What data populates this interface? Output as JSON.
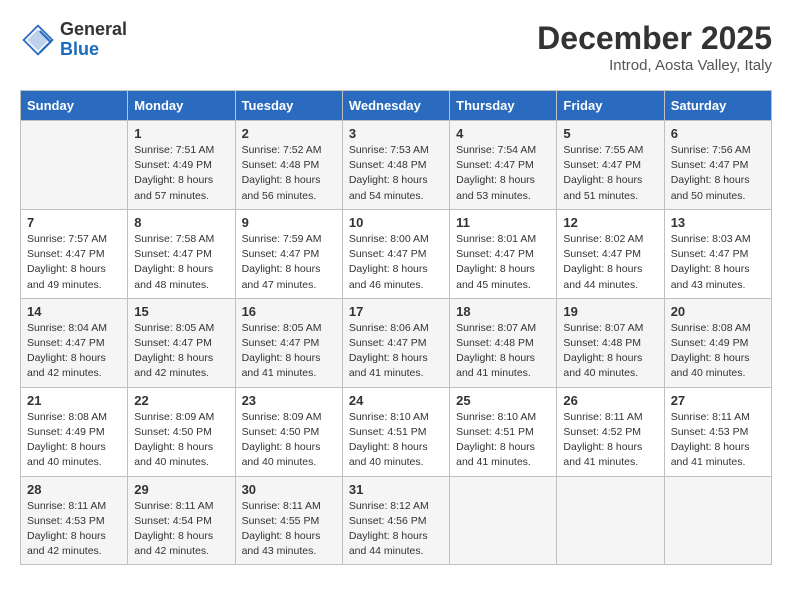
{
  "header": {
    "logo_general": "General",
    "logo_blue": "Blue",
    "month_year": "December 2025",
    "location": "Introd, Aosta Valley, Italy"
  },
  "days_of_week": [
    "Sunday",
    "Monday",
    "Tuesday",
    "Wednesday",
    "Thursday",
    "Friday",
    "Saturday"
  ],
  "weeks": [
    [
      {
        "day": "",
        "content": ""
      },
      {
        "day": "1",
        "content": "Sunrise: 7:51 AM\nSunset: 4:49 PM\nDaylight: 8 hours\nand 57 minutes."
      },
      {
        "day": "2",
        "content": "Sunrise: 7:52 AM\nSunset: 4:48 PM\nDaylight: 8 hours\nand 56 minutes."
      },
      {
        "day": "3",
        "content": "Sunrise: 7:53 AM\nSunset: 4:48 PM\nDaylight: 8 hours\nand 54 minutes."
      },
      {
        "day": "4",
        "content": "Sunrise: 7:54 AM\nSunset: 4:47 PM\nDaylight: 8 hours\nand 53 minutes."
      },
      {
        "day": "5",
        "content": "Sunrise: 7:55 AM\nSunset: 4:47 PM\nDaylight: 8 hours\nand 51 minutes."
      },
      {
        "day": "6",
        "content": "Sunrise: 7:56 AM\nSunset: 4:47 PM\nDaylight: 8 hours\nand 50 minutes."
      }
    ],
    [
      {
        "day": "7",
        "content": "Sunrise: 7:57 AM\nSunset: 4:47 PM\nDaylight: 8 hours\nand 49 minutes."
      },
      {
        "day": "8",
        "content": "Sunrise: 7:58 AM\nSunset: 4:47 PM\nDaylight: 8 hours\nand 48 minutes."
      },
      {
        "day": "9",
        "content": "Sunrise: 7:59 AM\nSunset: 4:47 PM\nDaylight: 8 hours\nand 47 minutes."
      },
      {
        "day": "10",
        "content": "Sunrise: 8:00 AM\nSunset: 4:47 PM\nDaylight: 8 hours\nand 46 minutes."
      },
      {
        "day": "11",
        "content": "Sunrise: 8:01 AM\nSunset: 4:47 PM\nDaylight: 8 hours\nand 45 minutes."
      },
      {
        "day": "12",
        "content": "Sunrise: 8:02 AM\nSunset: 4:47 PM\nDaylight: 8 hours\nand 44 minutes."
      },
      {
        "day": "13",
        "content": "Sunrise: 8:03 AM\nSunset: 4:47 PM\nDaylight: 8 hours\nand 43 minutes."
      }
    ],
    [
      {
        "day": "14",
        "content": "Sunrise: 8:04 AM\nSunset: 4:47 PM\nDaylight: 8 hours\nand 42 minutes."
      },
      {
        "day": "15",
        "content": "Sunrise: 8:05 AM\nSunset: 4:47 PM\nDaylight: 8 hours\nand 42 minutes."
      },
      {
        "day": "16",
        "content": "Sunrise: 8:05 AM\nSunset: 4:47 PM\nDaylight: 8 hours\nand 41 minutes."
      },
      {
        "day": "17",
        "content": "Sunrise: 8:06 AM\nSunset: 4:47 PM\nDaylight: 8 hours\nand 41 minutes."
      },
      {
        "day": "18",
        "content": "Sunrise: 8:07 AM\nSunset: 4:48 PM\nDaylight: 8 hours\nand 41 minutes."
      },
      {
        "day": "19",
        "content": "Sunrise: 8:07 AM\nSunset: 4:48 PM\nDaylight: 8 hours\nand 40 minutes."
      },
      {
        "day": "20",
        "content": "Sunrise: 8:08 AM\nSunset: 4:49 PM\nDaylight: 8 hours\nand 40 minutes."
      }
    ],
    [
      {
        "day": "21",
        "content": "Sunrise: 8:08 AM\nSunset: 4:49 PM\nDaylight: 8 hours\nand 40 minutes."
      },
      {
        "day": "22",
        "content": "Sunrise: 8:09 AM\nSunset: 4:50 PM\nDaylight: 8 hours\nand 40 minutes."
      },
      {
        "day": "23",
        "content": "Sunrise: 8:09 AM\nSunset: 4:50 PM\nDaylight: 8 hours\nand 40 minutes."
      },
      {
        "day": "24",
        "content": "Sunrise: 8:10 AM\nSunset: 4:51 PM\nDaylight: 8 hours\nand 40 minutes."
      },
      {
        "day": "25",
        "content": "Sunrise: 8:10 AM\nSunset: 4:51 PM\nDaylight: 8 hours\nand 41 minutes."
      },
      {
        "day": "26",
        "content": "Sunrise: 8:11 AM\nSunset: 4:52 PM\nDaylight: 8 hours\nand 41 minutes."
      },
      {
        "day": "27",
        "content": "Sunrise: 8:11 AM\nSunset: 4:53 PM\nDaylight: 8 hours\nand 41 minutes."
      }
    ],
    [
      {
        "day": "28",
        "content": "Sunrise: 8:11 AM\nSunset: 4:53 PM\nDaylight: 8 hours\nand 42 minutes."
      },
      {
        "day": "29",
        "content": "Sunrise: 8:11 AM\nSunset: 4:54 PM\nDaylight: 8 hours\nand 42 minutes."
      },
      {
        "day": "30",
        "content": "Sunrise: 8:11 AM\nSunset: 4:55 PM\nDaylight: 8 hours\nand 43 minutes."
      },
      {
        "day": "31",
        "content": "Sunrise: 8:12 AM\nSunset: 4:56 PM\nDaylight: 8 hours\nand 44 minutes."
      },
      {
        "day": "",
        "content": ""
      },
      {
        "day": "",
        "content": ""
      },
      {
        "day": "",
        "content": ""
      }
    ]
  ]
}
